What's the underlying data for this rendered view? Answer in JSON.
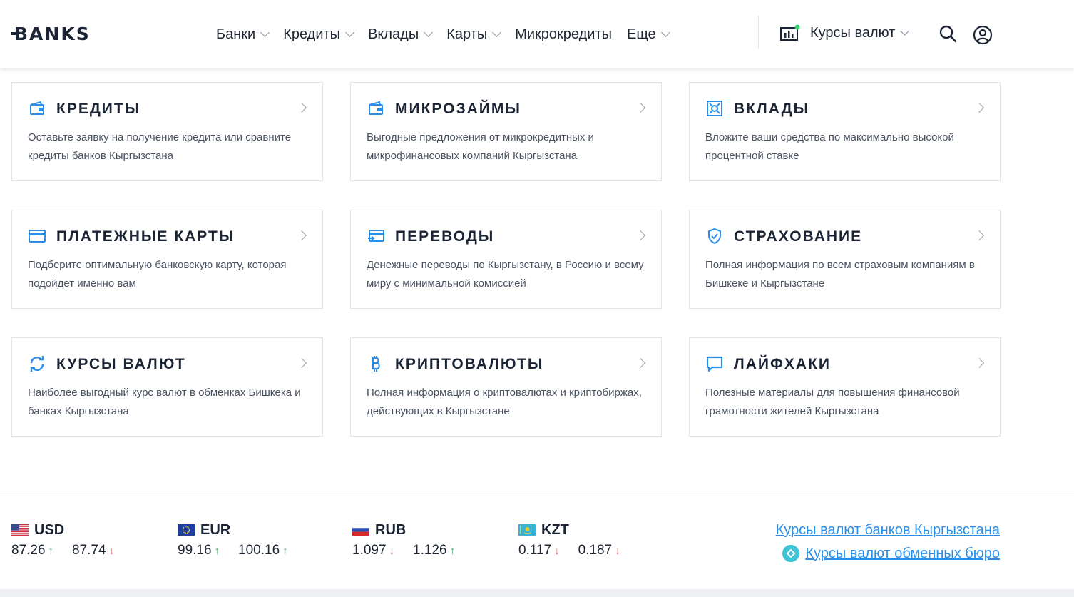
{
  "header": {
    "logo": "BANKS",
    "nav": [
      {
        "label": "Банки",
        "dropdown": true
      },
      {
        "label": "Кредиты",
        "dropdown": true
      },
      {
        "label": "Вклады",
        "dropdown": true
      },
      {
        "label": "Карты",
        "dropdown": true
      },
      {
        "label": "Микрокредиты",
        "dropdown": false
      },
      {
        "label": "Еще",
        "dropdown": true
      }
    ],
    "rates_label": "Курсы валют",
    "icons": {
      "rates": "chart-bars-icon",
      "search": "search-icon",
      "user": "user-circle-icon"
    }
  },
  "cards": [
    {
      "title": "КРЕДИТЫ",
      "desc": "Оставьте заявку на получение кредита или сравните кредиты банков Кыргызстана",
      "icon": "wallet-icon"
    },
    {
      "title": "МИКРОЗАЙМЫ",
      "desc": "Выгодные предложения от микрокредитных и микрофинансовых компаний Кыргызстана",
      "icon": "wallet-icon"
    },
    {
      "title": "ВКЛАДЫ",
      "desc": "Вложите ваши средства по максимально высокой процентной ставке",
      "icon": "safe-icon"
    },
    {
      "title": "ПЛАТЕЖНЫЕ КАРТЫ",
      "desc": "Подберите оптимальную банковскую карту, которая подойдет именно вам",
      "icon": "card-icon"
    },
    {
      "title": "ПЕРЕВОДЫ",
      "desc": "Денежные переводы по Кыргызстану, в Россию и всему миру с минимальной комиссией",
      "icon": "transfer-icon"
    },
    {
      "title": "СТРАХОВАНИЕ",
      "desc": "Полная информация по всем страховым компаниям в Бишкеке и Кыргызстане",
      "icon": "shield-icon"
    },
    {
      "title": "КУРСЫ ВАЛЮТ",
      "desc": "Наиболее выгодный курс валют в обменках Бишкека и банках Кыргызстана",
      "icon": "refresh-icon"
    },
    {
      "title": "КРИПТОВАЛЮТЫ",
      "desc": "Полная информация о криптовалютах и криптобиржах, действующих в Кыргызстане",
      "icon": "bitcoin-icon"
    },
    {
      "title": "ЛАЙФХАКИ",
      "desc": "Полезные материалы для повышения финансовой грамотности жителей Кыргызстана",
      "icon": "chat-icon"
    }
  ],
  "currencies": [
    {
      "code": "USD",
      "flag": "us-flag-icon",
      "buy": "87.26",
      "buy_dir": "up",
      "sell": "87.74",
      "sell_dir": "down"
    },
    {
      "code": "EUR",
      "flag": "eu-flag-icon",
      "buy": "99.16",
      "buy_dir": "up",
      "sell": "100.16",
      "sell_dir": "up"
    },
    {
      "code": "RUB",
      "flag": "ru-flag-icon",
      "buy": "1.097",
      "buy_dir": "down",
      "sell": "1.126",
      "sell_dir": "up"
    },
    {
      "code": "KZT",
      "flag": "kz-flag-icon",
      "buy": "0.117",
      "buy_dir": "down",
      "sell": "0.187",
      "sell_dir": "down"
    }
  ],
  "links": {
    "banks_rates": "Курсы валют банков Кыргызстана",
    "exchange_rates": "Курсы валют обменных бюро"
  },
  "colors": {
    "accent": "#2b8de6",
    "up": "#3bb56b",
    "down": "#e0685f",
    "text": "#1b2434"
  }
}
